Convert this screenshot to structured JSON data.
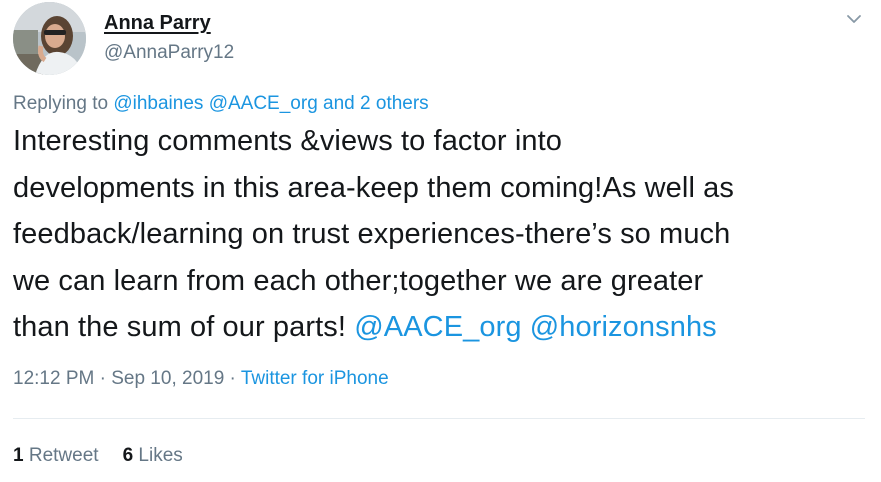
{
  "author": {
    "display_name": "Anna Parry",
    "handle": "@AnnaParry12"
  },
  "menu": {
    "icon": "chevron-down-icon"
  },
  "reply_context": {
    "prefix": "Replying to",
    "mention_1": "@ihbaines",
    "mention_2": "@AACE_org",
    "and": "and",
    "others": "2 others"
  },
  "tweet": {
    "lines": [
      "Interesting comments &views to factor into",
      "developments in this area-keep them coming!As well as",
      "feedback/learning on trust experiences-there’s so much",
      "we can learn from each other;together we are greater",
      "than the sum of our parts!"
    ],
    "mentions": [
      "@AACE_org",
      "@horizonsnhs"
    ]
  },
  "meta": {
    "time": "12:12 PM",
    "separator": "·",
    "date": "Sep 10, 2019",
    "source": "Twitter for iPhone"
  },
  "stats": {
    "retweets_count": "1",
    "retweets_label": "Retweet",
    "likes_count": "6",
    "likes_label": "Likes"
  },
  "colors": {
    "link": "#1b95e0",
    "secondary_text": "#657786",
    "primary_text": "#14171a",
    "divider": "#e6ecf0"
  }
}
